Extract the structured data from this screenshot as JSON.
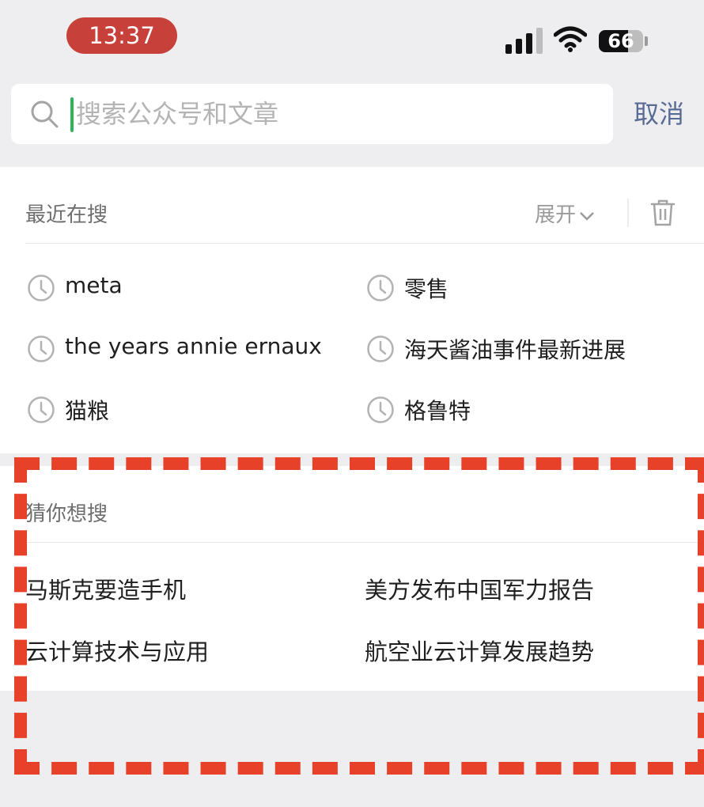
{
  "status_bar": {
    "time": "13:37",
    "battery_level": "66",
    "signal_icon": "cellular-signal-icon",
    "wifi_icon": "wifi-icon"
  },
  "search": {
    "placeholder": "搜索公众号和文章",
    "value": "",
    "cancel_label": "取消"
  },
  "recent": {
    "title": "最近在搜",
    "expand_label": "展开",
    "items": [
      "meta",
      "零售",
      "the years annie ernaux",
      "海天酱油事件最新进展",
      "猫粮",
      "格鲁特"
    ]
  },
  "guess": {
    "title": "猜你想搜",
    "items": [
      "马斯克要造手机",
      "美方发布中国军力报告",
      "云计算技术与应用",
      "航空业云计算发展趋势"
    ]
  },
  "colors": {
    "time_pill": "#c8403a",
    "accent_link": "#586b94",
    "highlight": "#e8412a",
    "cursor": "#2cb55a"
  }
}
